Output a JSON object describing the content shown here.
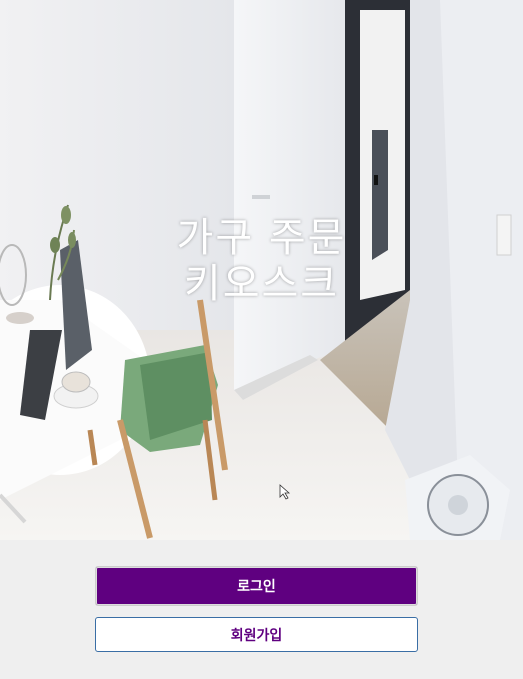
{
  "hero": {
    "title_line1": "가구 주문",
    "title_line2": "키오스크",
    "image": "room-interior-photo"
  },
  "actions": {
    "login_label": "로그인",
    "signup_label": "회원가입"
  },
  "colors": {
    "primary": "#5f0080",
    "background": "#efefef",
    "signup_border": "#3a6ea5"
  }
}
